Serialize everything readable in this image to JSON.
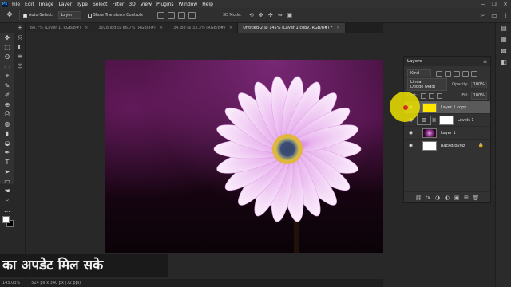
{
  "menubar": {
    "logo": "Ps",
    "items": [
      "File",
      "Edit",
      "Image",
      "Layer",
      "Type",
      "Select",
      "Filter",
      "3D",
      "View",
      "Plugins",
      "Window",
      "Help"
    ],
    "window_controls": [
      "—",
      "❐",
      "✕"
    ]
  },
  "options": {
    "auto_select_label": "Auto-Select:",
    "auto_select_target": "Layer",
    "show_transform_label": "Show Transform Controls",
    "mode_3d_label": "3D Mode:",
    "mode_3d_icons": [
      "⟲",
      "✥",
      "✣",
      "⇔",
      "▣"
    ],
    "right_icons": [
      "⌕",
      "▭",
      "⇪"
    ]
  },
  "tabs": [
    {
      "label": "66.7% (Layer 1, RGB/8#)",
      "active": false
    },
    {
      "label": "3028.jpg @ 66.7% (RGB/8#)",
      "active": false
    },
    {
      "label": "34.jpg @ 33.3% (RGB/8#)",
      "active": false
    },
    {
      "label": "Untitled-2 @ 145% (Layer 1 copy, RGB/8#) *",
      "active": true
    }
  ],
  "tools": [
    "✥",
    "⬚",
    "ʘ",
    "⬚",
    "⌖",
    "✎",
    "✐",
    "⊕",
    "⎙",
    "◍",
    "▮",
    "◒",
    "✒",
    "T",
    "➤",
    "▭",
    "☚",
    "⌕",
    "…"
  ],
  "sidecol_icons": [
    "⊞",
    "⎌",
    "◐",
    "≡",
    "⊡"
  ],
  "panel_icons": [
    "▤",
    "▦",
    "▩",
    "◧"
  ],
  "layers_panel": {
    "title": "Layers",
    "menu_icon": "≡",
    "filter_kind": "Kind",
    "blend_mode": "Linear Dodge (Add)",
    "opacity_label": "Opacity:",
    "opacity_value": "100%",
    "lock_label": "Lock:",
    "fill_label": "Fill:",
    "fill_value": "100%",
    "layers": [
      {
        "name": "Layer 1 copy",
        "thumb": "yellow",
        "selected": true
      },
      {
        "name": "Levels 1",
        "thumb": "adj",
        "selected": false
      },
      {
        "name": "Layer 1",
        "thumb": "flower",
        "selected": false
      },
      {
        "name": "Background",
        "thumb": "white",
        "selected": false,
        "locked": true
      }
    ],
    "footer_icons": [
      "⛓",
      "fx",
      "◑",
      "◐",
      "▣",
      "⊞",
      "🗑"
    ]
  },
  "caption": "का अपडेट मिल सके",
  "status": {
    "zoom": "145.03%",
    "doc_size": "514 px x 340 px (72 ppi)"
  },
  "colors": {
    "highlight": "#ebe100",
    "selected_row": "#5a5a5a",
    "petal": "#f2c9f2"
  }
}
